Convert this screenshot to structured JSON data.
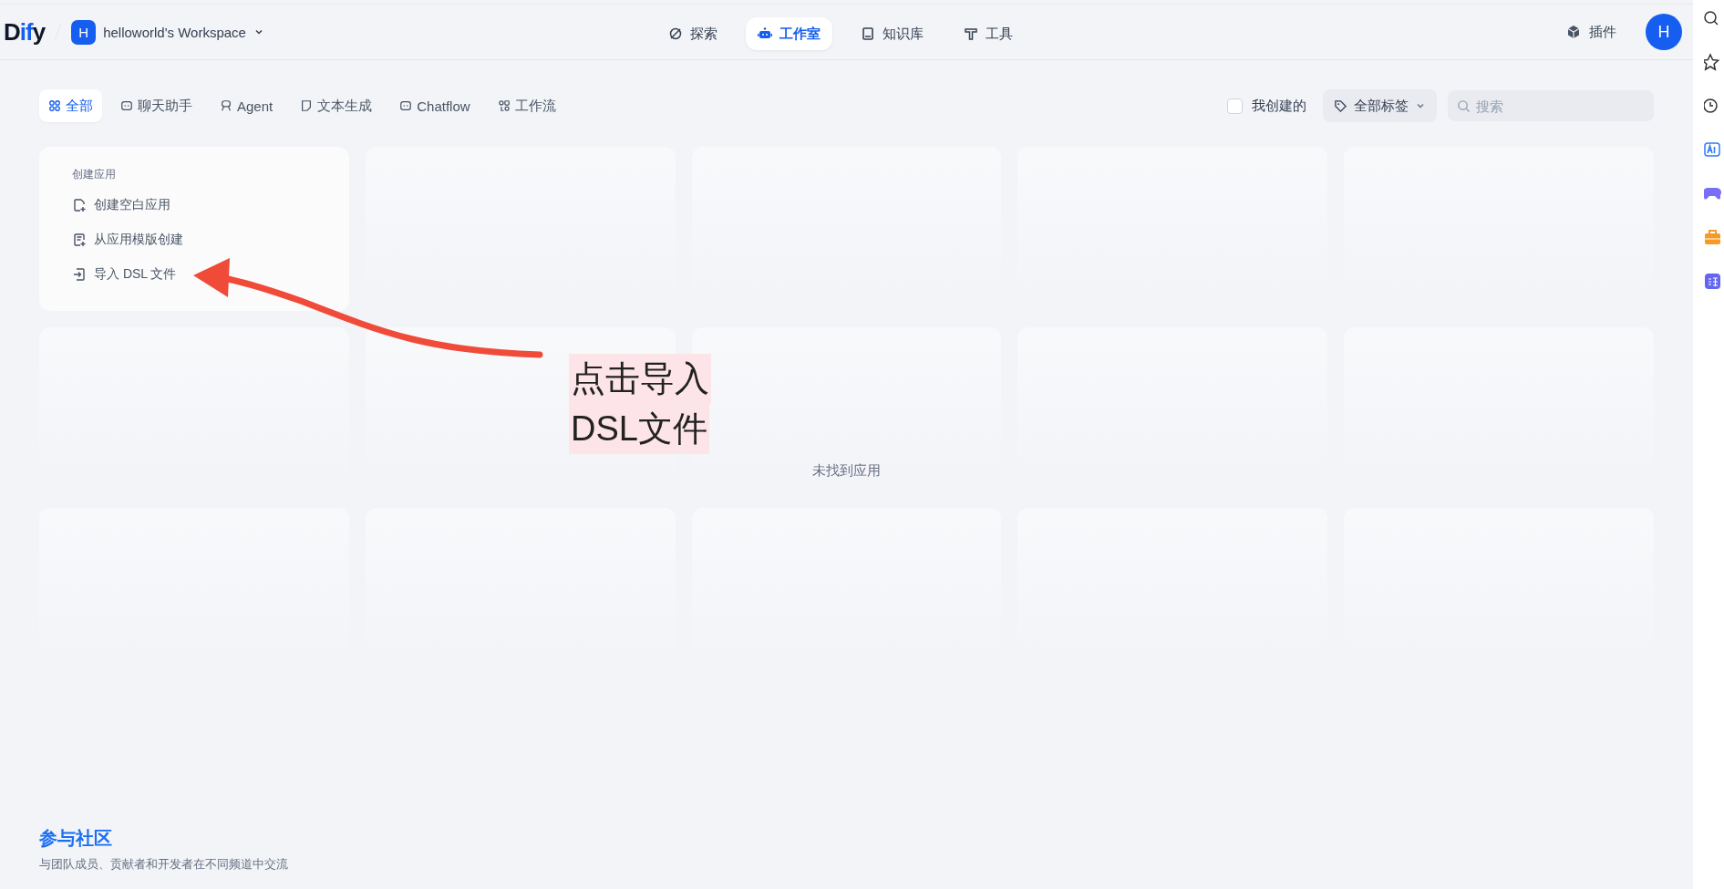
{
  "logo": "Dify",
  "workspace": {
    "initial": "H",
    "name": "helloworld's Workspace"
  },
  "nav": [
    {
      "kind": "explore",
      "label": "探索",
      "selected": false
    },
    {
      "kind": "studio",
      "label": "工作室",
      "selected": true
    },
    {
      "kind": "knowledge",
      "label": "知识库",
      "selected": false
    },
    {
      "kind": "tools",
      "label": "工具",
      "selected": false
    }
  ],
  "plugins": "插件",
  "avatar": "H",
  "filters": [
    {
      "kind": "all",
      "label": "全部",
      "selected": true
    },
    {
      "kind": "chat",
      "label": "聊天助手",
      "selected": false
    },
    {
      "kind": "agent",
      "label": "Agent",
      "selected": false
    },
    {
      "kind": "text",
      "label": "文本生成",
      "selected": false
    },
    {
      "kind": "chatflow",
      "label": "Chatflow",
      "selected": false
    },
    {
      "kind": "workflow",
      "label": "工作流",
      "selected": false
    }
  ],
  "my_created": {
    "label": "我创建的",
    "checked": false
  },
  "tag_filter": "全部标签",
  "search": {
    "placeholder": "搜索"
  },
  "create_card": {
    "title": "创建应用",
    "items": [
      {
        "kind": "blank",
        "label": "创建空白应用"
      },
      {
        "kind": "template",
        "label": "从应用模版创建"
      },
      {
        "kind": "import",
        "label": "导入 DSL 文件"
      }
    ]
  },
  "empty_message": "未找到应用",
  "community": {
    "title": "参与社区",
    "subtitle": "与团队成员、贡献者和开发者在不同频道中交流"
  },
  "annotation": {
    "lines": [
      "点击导入",
      "DSL文件"
    ]
  }
}
